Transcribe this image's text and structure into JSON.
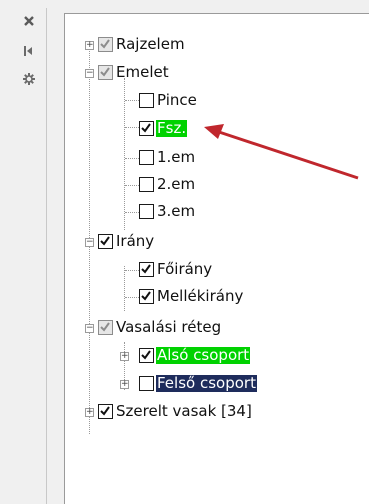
{
  "toolbar": {
    "close_icon": "close-icon",
    "dock_icon": "dock-icon",
    "settings_icon": "gear-icon"
  },
  "tree": {
    "rajzelem": "Rajzelem",
    "emelet": "Emelet",
    "pince": "Pince",
    "fsz": "Fsz.",
    "em1": "1.em",
    "em2": "2.em",
    "em3": "3.em",
    "irany": "Irány",
    "foirany": "Főirány",
    "mellekirany": "Mellékirány",
    "vasalasi_reteg": "Vasalási réteg",
    "also_csoport": "Alsó csoport",
    "felso_csoport": "Felső csoport",
    "szerelt_vasak": "Szerelt vasak [34]"
  },
  "colors": {
    "highlight_green": "#00d200",
    "highlight_navy": "#1e2c5c",
    "arrow": "#c0272d"
  }
}
